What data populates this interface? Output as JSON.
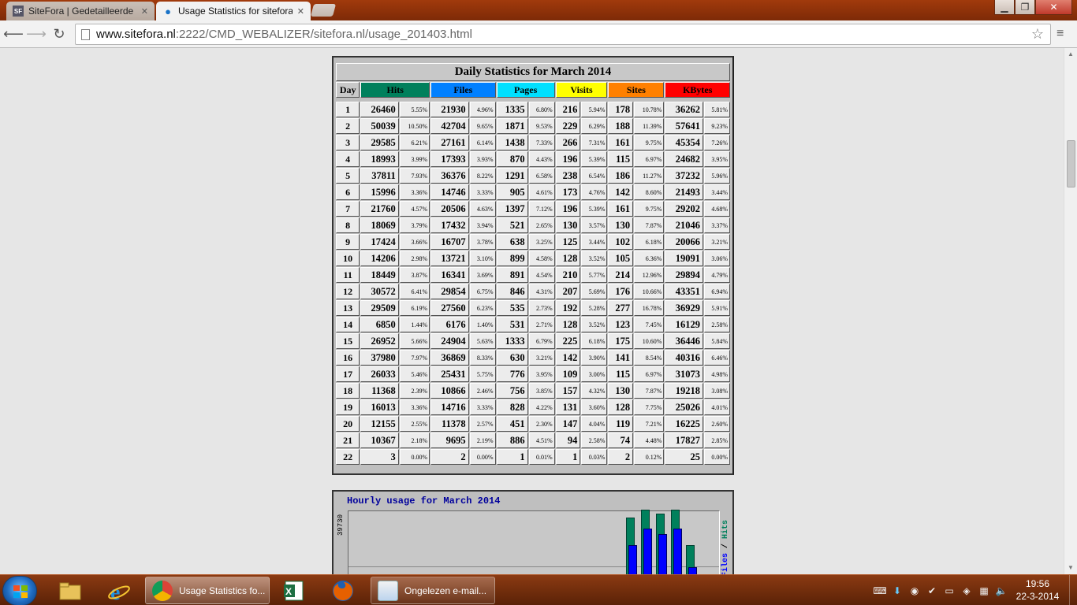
{
  "browser": {
    "tabs": [
      {
        "label": "SiteFora | Gedetailleerde o",
        "favicon": "SF",
        "active": false
      },
      {
        "label": "Usage Statistics for sitefora",
        "favicon": "●",
        "active": true
      }
    ],
    "address": {
      "host": "www.sitefora.nl",
      "rest": ":2222/CMD_WEBALIZER/sitefora.nl/usage_201403.html"
    },
    "window_buttons": {
      "minimize": "▁",
      "maximize": "❐",
      "close": "✕"
    }
  },
  "stats": {
    "title": "Daily Statistics for March 2014",
    "headers": {
      "day": "Day",
      "hits": "Hits",
      "files": "Files",
      "pages": "Pages",
      "visits": "Visits",
      "sites": "Sites",
      "kbytes": "KBytes"
    },
    "header_colors": {
      "hits": "#00805c",
      "files": "#0080ff",
      "pages": "#00e0ff",
      "visits": "#ffff00",
      "sites": "#ff8000",
      "kbytes": "#ff0000"
    },
    "rows": [
      [
        "1",
        "26460",
        "5.55%",
        "21930",
        "4.96%",
        "1335",
        "6.80%",
        "216",
        "5.94%",
        "178",
        "10.78%",
        "36262",
        "5.81%"
      ],
      [
        "2",
        "50039",
        "10.50%",
        "42704",
        "9.65%",
        "1871",
        "9.53%",
        "229",
        "6.29%",
        "188",
        "11.39%",
        "57641",
        "9.23%"
      ],
      [
        "3",
        "29585",
        "6.21%",
        "27161",
        "6.14%",
        "1438",
        "7.33%",
        "266",
        "7.31%",
        "161",
        "9.75%",
        "45354",
        "7.26%"
      ],
      [
        "4",
        "18993",
        "3.99%",
        "17393",
        "3.93%",
        "870",
        "4.43%",
        "196",
        "5.39%",
        "115",
        "6.97%",
        "24682",
        "3.95%"
      ],
      [
        "5",
        "37811",
        "7.93%",
        "36376",
        "8.22%",
        "1291",
        "6.58%",
        "238",
        "6.54%",
        "186",
        "11.27%",
        "37232",
        "5.96%"
      ],
      [
        "6",
        "15996",
        "3.36%",
        "14746",
        "3.33%",
        "905",
        "4.61%",
        "173",
        "4.76%",
        "142",
        "8.60%",
        "21493",
        "3.44%"
      ],
      [
        "7",
        "21760",
        "4.57%",
        "20506",
        "4.63%",
        "1397",
        "7.12%",
        "196",
        "5.39%",
        "161",
        "9.75%",
        "29202",
        "4.68%"
      ],
      [
        "8",
        "18069",
        "3.79%",
        "17432",
        "3.94%",
        "521",
        "2.65%",
        "130",
        "3.57%",
        "130",
        "7.87%",
        "21046",
        "3.37%"
      ],
      [
        "9",
        "17424",
        "3.66%",
        "16707",
        "3.78%",
        "638",
        "3.25%",
        "125",
        "3.44%",
        "102",
        "6.18%",
        "20066",
        "3.21%"
      ],
      [
        "10",
        "14206",
        "2.98%",
        "13721",
        "3.10%",
        "899",
        "4.58%",
        "128",
        "3.52%",
        "105",
        "6.36%",
        "19091",
        "3.06%"
      ],
      [
        "11",
        "18449",
        "3.87%",
        "16341",
        "3.69%",
        "891",
        "4.54%",
        "210",
        "5.77%",
        "214",
        "12.96%",
        "29894",
        "4.79%"
      ],
      [
        "12",
        "30572",
        "6.41%",
        "29854",
        "6.75%",
        "846",
        "4.31%",
        "207",
        "5.69%",
        "176",
        "10.66%",
        "43351",
        "6.94%"
      ],
      [
        "13",
        "29509",
        "6.19%",
        "27560",
        "6.23%",
        "535",
        "2.73%",
        "192",
        "5.28%",
        "277",
        "16.78%",
        "36929",
        "5.91%"
      ],
      [
        "14",
        "6850",
        "1.44%",
        "6176",
        "1.40%",
        "531",
        "2.71%",
        "128",
        "3.52%",
        "123",
        "7.45%",
        "16129",
        "2.58%"
      ],
      [
        "15",
        "26952",
        "5.66%",
        "24904",
        "5.63%",
        "1333",
        "6.79%",
        "225",
        "6.18%",
        "175",
        "10.60%",
        "36446",
        "5.84%"
      ],
      [
        "16",
        "37980",
        "7.97%",
        "36869",
        "8.33%",
        "630",
        "3.21%",
        "142",
        "3.90%",
        "141",
        "8.54%",
        "40316",
        "6.46%"
      ],
      [
        "17",
        "26033",
        "5.46%",
        "25431",
        "5.75%",
        "776",
        "3.95%",
        "109",
        "3.00%",
        "115",
        "6.97%",
        "31073",
        "4.98%"
      ],
      [
        "18",
        "11368",
        "2.39%",
        "10866",
        "2.46%",
        "756",
        "3.85%",
        "157",
        "4.32%",
        "130",
        "7.87%",
        "19218",
        "3.08%"
      ],
      [
        "19",
        "16013",
        "3.36%",
        "14716",
        "3.33%",
        "828",
        "4.22%",
        "131",
        "3.60%",
        "128",
        "7.75%",
        "25026",
        "4.01%"
      ],
      [
        "20",
        "12155",
        "2.55%",
        "11378",
        "2.57%",
        "451",
        "2.30%",
        "147",
        "4.04%",
        "119",
        "7.21%",
        "16225",
        "2.60%"
      ],
      [
        "21",
        "10367",
        "2.18%",
        "9695",
        "2.19%",
        "886",
        "4.51%",
        "94",
        "2.58%",
        "74",
        "4.48%",
        "17827",
        "2.85%"
      ],
      [
        "22",
        "3",
        "0.00%",
        "2",
        "0.00%",
        "1",
        "0.01%",
        "1",
        "0.03%",
        "2",
        "0.12%",
        "25",
        "0.00%"
      ]
    ]
  },
  "hourly": {
    "title": "Hourly usage for March 2014",
    "ymax": "39730",
    "legend_files": "Files",
    "legend_sep": " / ",
    "legend_hits": "Hits",
    "hits_color": "#00805c",
    "files_color": "#0000ff"
  },
  "chart_data": {
    "type": "bar",
    "title": "Hourly usage for March 2014",
    "ylim": [
      0,
      39730
    ],
    "series": [
      {
        "name": "Hits",
        "values": [
          37000,
          39700,
          38300,
          39730,
          27000
        ]
      },
      {
        "name": "Files",
        "values": [
          32000,
          38000,
          36000,
          38000,
          24000
        ]
      }
    ]
  },
  "taskbar": {
    "tasks": [
      {
        "label": "Usage Statistics fo...",
        "active": true
      },
      {
        "label": "Ongelezen e-mail..."
      }
    ],
    "clock_time": "19:56",
    "clock_date": "22-3-2014"
  }
}
